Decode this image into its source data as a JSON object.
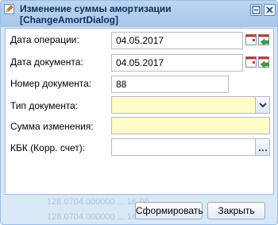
{
  "window": {
    "title_line1": "Изменение суммы амортизации",
    "title_line2": "[ChangeAmortDialog]",
    "minimize_icon": "window-minimize-icon",
    "close_icon": "window-close-icon"
  },
  "form": {
    "operation_date": {
      "label": "Дата операции:",
      "value": "04.05.2017"
    },
    "document_date": {
      "label": "Дата документа:",
      "value": "04.05.2017"
    },
    "document_number": {
      "label": "Номер документа:",
      "value": "88"
    },
    "document_type": {
      "label": "Тип документа:",
      "value": ""
    },
    "change_amount": {
      "label": "Сумма изменения:",
      "value": ""
    },
    "kbk": {
      "label": "КБК (Корр. счет):",
      "value": ""
    }
  },
  "background_rows": [
    "128.0704.000000 ... 16.06",
    "128.0704.000000 ... 16.06"
  ],
  "buttons": {
    "generate": "Сформировать",
    "close": "Закрыть"
  },
  "colors": {
    "window_bg": "#d9e8f6",
    "required_field": "#fffec8",
    "title_text": "#0e2f5a"
  }
}
